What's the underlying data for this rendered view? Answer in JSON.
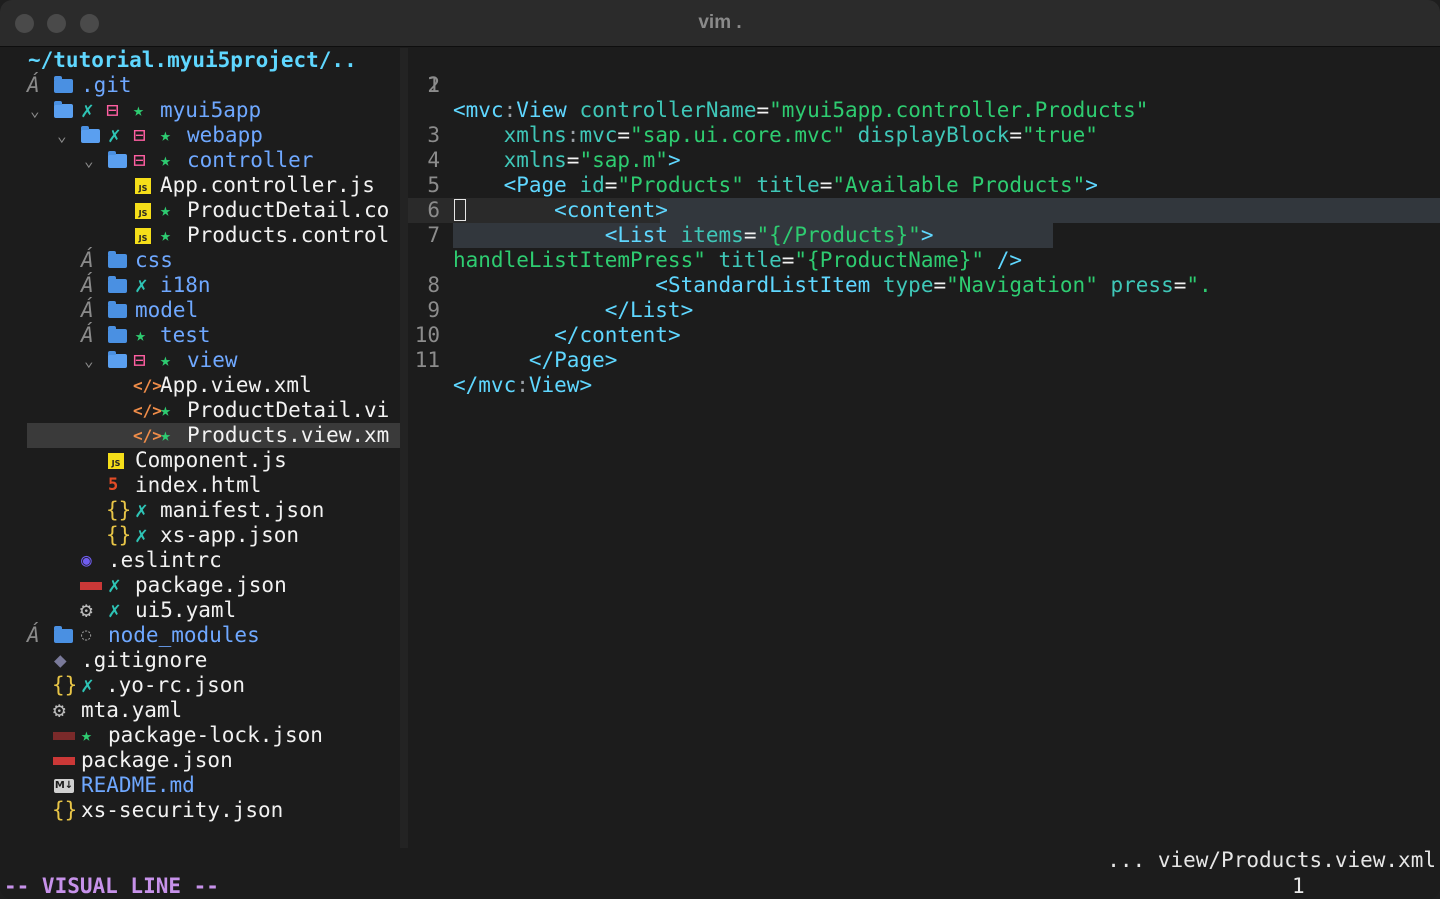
{
  "window": {
    "title": "vim ."
  },
  "tree": {
    "root": "~/tutorial.myui5project/..",
    "items": [
      {
        "label": ".git"
      },
      {
        "label": "myui5app"
      },
      {
        "label": "webapp"
      },
      {
        "label": "controller"
      },
      {
        "label": "App.controller.js"
      },
      {
        "label": "ProductDetail.co"
      },
      {
        "label": "Products.control"
      },
      {
        "label": "css"
      },
      {
        "label": "i18n"
      },
      {
        "label": "model"
      },
      {
        "label": "test"
      },
      {
        "label": "view"
      },
      {
        "label": "App.view.xml"
      },
      {
        "label": "ProductDetail.vi"
      },
      {
        "label": "Products.view.xm"
      },
      {
        "label": "Component.js"
      },
      {
        "label": "index.html"
      },
      {
        "label": "manifest.json"
      },
      {
        "label": "xs-app.json"
      },
      {
        "label": ".eslintrc"
      },
      {
        "label": "package.json"
      },
      {
        "label": "ui5.yaml"
      },
      {
        "label": "node_modules"
      },
      {
        "label": ".gitignore"
      },
      {
        "label": ".yo-rc.json"
      },
      {
        "label": "mta.yaml"
      },
      {
        "label": "package-lock.json"
      },
      {
        "label": "package.json"
      },
      {
        "label": "README.md"
      },
      {
        "label": "xs-security.json"
      }
    ]
  },
  "editor": {
    "lines": [
      {
        "n": "1"
      },
      {
        "n": "2"
      },
      {
        "n": "3"
      },
      {
        "n": "4"
      },
      {
        "n": "5"
      },
      {
        "n": "6"
      },
      {
        "n": "7"
      },
      {
        "n": "8"
      },
      {
        "n": "9"
      },
      {
        "n": "10"
      },
      {
        "n": "11"
      }
    ],
    "tokens": {
      "l1_tag": "<mvc",
      "l1_colon": ":",
      "l1_view": "View",
      "l1_attr": "controllerName",
      "l1_eq": "=",
      "l1_str": "\"myui5app.controller.Products\"",
      "l2_a": "xmlns",
      "l2_colon": ":",
      "l2_b": "mvc",
      "l2_eq": "=",
      "l2_str": "\"sap.ui.core.mvc\"",
      "l2_attr": "displayBlock",
      "l2_eq2": "=",
      "l2_str2": "\"true\"",
      "l3_attr": "xmlns",
      "l3_eq": "=",
      "l3_str": "\"sap.m\"",
      "l3_end": ">",
      "l4_tag": "<Page",
      "l4_a1": "id",
      "l4_eq1": "=",
      "l4_s1": "\"Products\"",
      "l4_a2": "title",
      "l4_eq2": "=",
      "l4_s2": "\"Available Products\"",
      "l4_end": ">",
      "l5": "<content>",
      "l6_tag": "<List",
      "l6_attr": "items",
      "l6_eq": "=",
      "l6_str": "\"{/Products}\"",
      "l6_end": ">",
      "l7_tag": "<StandardListItem",
      "l7_a1": "type",
      "l7_eq1": "=",
      "l7_s1": "\"Navigation\"",
      "l7_a2": "press",
      "l7_eq2": "=",
      "l7_s2": "\".",
      "l7b_s": "handleListItemPress\"",
      "l7b_a": "title",
      "l7b_eq": "=",
      "l7b_s2": "\"{ProductName}\"",
      "l7b_end": "/>",
      "l8": "</List>",
      "l9": "</content>",
      "l10": "</Page>",
      "l11_tag": "</mvc",
      "l11_colon": ":",
      "l11_view": "View>"
    }
  },
  "status": {
    "path": "... view/Products.view.xml",
    "mode": "-- VISUAL LINE --",
    "count": "1"
  },
  "colors": {
    "accent": "#5fd7ff",
    "string": "#2ecc71",
    "attr": "#3fc7b8",
    "mode": "#c792ea"
  }
}
